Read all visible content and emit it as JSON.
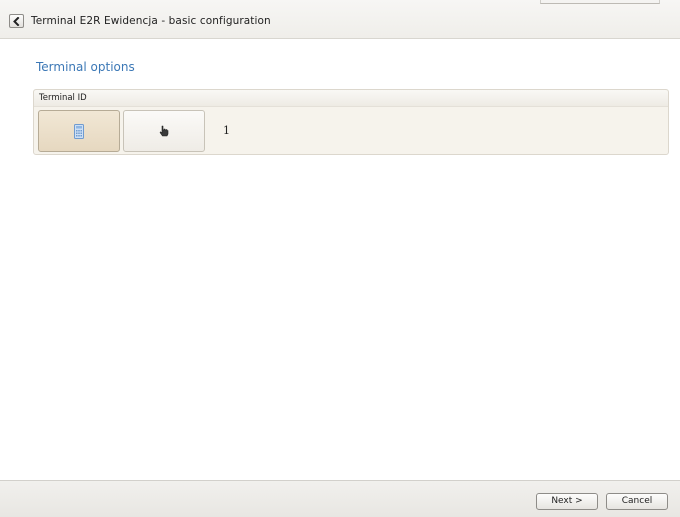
{
  "window": {
    "title": "Terminal E2R Ewidencja - basic configuration"
  },
  "header": {
    "back_icon": "chevron-left-icon"
  },
  "section": {
    "title": "Terminal options"
  },
  "terminal_id_group": {
    "label": "Terminal ID",
    "modes": [
      {
        "icon": "keypad-icon",
        "selected": true
      },
      {
        "icon": "hand-pointer-icon",
        "selected": false
      }
    ],
    "value": "1"
  },
  "footer": {
    "next_label": "Next >",
    "cancel_label": "Cancel"
  },
  "colors": {
    "accent": "#3c78b6",
    "selected_button": "#e9dcc6",
    "panel_background": "#f6f3ec"
  }
}
